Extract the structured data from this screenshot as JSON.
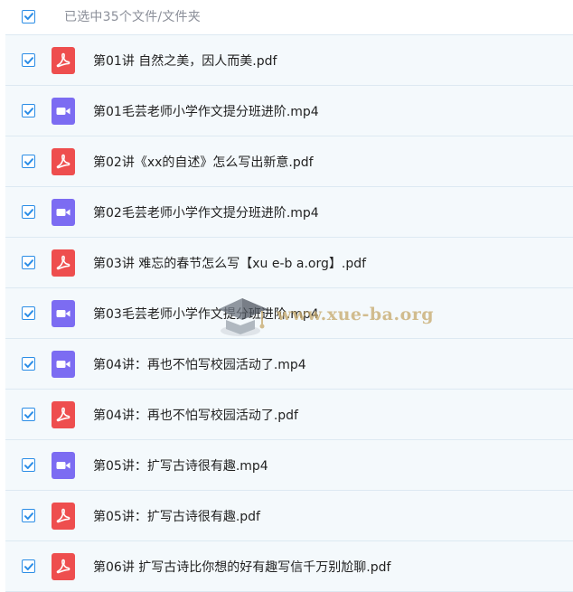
{
  "header": {
    "checked": true,
    "selected_text": "已选中35个文件/文件夹"
  },
  "files": [
    {
      "name": "第01讲 自然之美，因人而美.pdf",
      "type": "pdf",
      "icon": "pdf-icon",
      "checked": true
    },
    {
      "name": "第01毛芸老师小学作文提分班进阶.mp4",
      "type": "video",
      "icon": "video-icon",
      "checked": true
    },
    {
      "name": "第02讲《xx的自述》怎么写出新意.pdf",
      "type": "pdf",
      "icon": "pdf-icon",
      "checked": true
    },
    {
      "name": "第02毛芸老师小学作文提分班进阶.mp4",
      "type": "video",
      "icon": "video-icon",
      "checked": true
    },
    {
      "name": "第03讲 难忘的春节怎么写【xu e-b a.org】.pdf",
      "type": "pdf",
      "icon": "pdf-icon",
      "checked": true
    },
    {
      "name": "第03毛芸老师小学作文提分班进阶.mp4",
      "type": "video",
      "icon": "video-icon",
      "checked": true
    },
    {
      "name": "第04讲：再也不怕写校园活动了.mp4",
      "type": "video",
      "icon": "video-icon",
      "checked": true
    },
    {
      "name": "第04讲：再也不怕写校园活动了.pdf",
      "type": "pdf",
      "icon": "pdf-icon",
      "checked": true
    },
    {
      "name": "第05讲：扩写古诗很有趣.mp4",
      "type": "video",
      "icon": "video-icon",
      "checked": true
    },
    {
      "name": "第05讲：扩写古诗很有趣.pdf",
      "type": "pdf",
      "icon": "pdf-icon",
      "checked": true
    },
    {
      "name": "第06讲 扩写古诗比你想的好有趣写信千万别尬聊.pdf",
      "type": "pdf",
      "icon": "pdf-icon",
      "checked": true
    }
  ],
  "watermark": {
    "text": "www.xue-ba.org",
    "icon": "graduation-cap-icon"
  },
  "colors": {
    "checkbox": "#2b8de6",
    "pdf": "#ee4e4e",
    "video": "#7c6cf2",
    "row_bg": "#f4f9fc",
    "divider": "#dde9f2"
  }
}
